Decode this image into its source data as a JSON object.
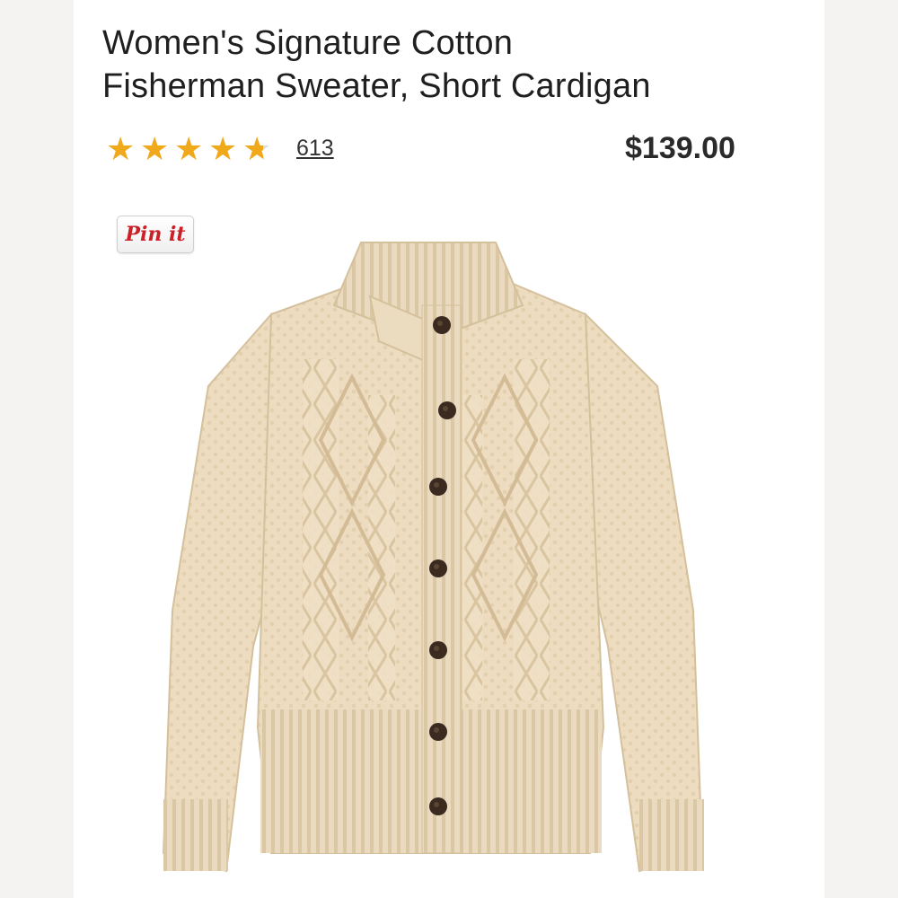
{
  "product": {
    "title_line1": "Women's Signature Cotton",
    "title_line2": "Fisherman Sweater, Short Cardigan",
    "rating": 4.6,
    "review_count": "613",
    "price": "$139.00"
  },
  "pin_button": {
    "label": "Pin it"
  },
  "colors": {
    "star": "#f0a91a",
    "sweater": "#eddcc0",
    "button": "#3a2a20",
    "pin_red": "#cb2027"
  },
  "icons": {
    "stars": [
      "star-filled-icon",
      "star-filled-icon",
      "star-filled-icon",
      "star-filled-icon",
      "star-half-icon"
    ]
  }
}
